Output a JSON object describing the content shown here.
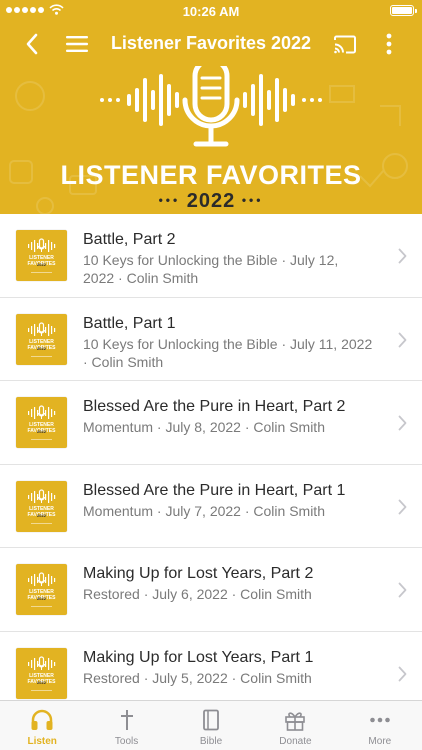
{
  "status_bar": {
    "time": "10:26 AM"
  },
  "header": {
    "title": "Listener Favorites 2022"
  },
  "banner": {
    "title": "LISTENER FAVORITES",
    "year": "2022",
    "dots": "•••"
  },
  "thumbnail": {
    "title": "LISTENER FAVORITES",
    "year": "2022"
  },
  "episodes": [
    {
      "title": "Battle, Part 2",
      "subtitle": "10 Keys for Unlocking the Bible · July 12, 2022 · Colin Smith"
    },
    {
      "title": "Battle, Part 1",
      "subtitle": "10 Keys for Unlocking the Bible · July 11, 2022 · Colin Smith"
    },
    {
      "title": "Blessed Are the Pure in Heart, Part 2",
      "subtitle": "Momentum · July 8, 2022 · Colin Smith"
    },
    {
      "title": "Blessed Are the Pure in Heart, Part 1",
      "subtitle": "Momentum · July 7, 2022 · Colin Smith"
    },
    {
      "title": "Making Up for Lost Years, Part 2",
      "subtitle": "Restored · July 6, 2022 · Colin Smith"
    },
    {
      "title": "Making Up for Lost Years, Part 1",
      "subtitle": "Restored · July 5, 2022 · Colin Smith"
    }
  ],
  "tabs": [
    {
      "label": "Listen",
      "icon": "headphones-icon",
      "active": true
    },
    {
      "label": "Tools",
      "icon": "cross-icon",
      "active": false
    },
    {
      "label": "Bible",
      "icon": "book-icon",
      "active": false
    },
    {
      "label": "Donate",
      "icon": "gift-icon",
      "active": false
    },
    {
      "label": "More",
      "icon": "more-dots-icon",
      "active": false
    }
  ],
  "colors": {
    "accent": "#e2b322",
    "text": "#2b2b2b",
    "secondary_text": "#7a7a7a",
    "inactive_tab": "#8e8e93"
  }
}
